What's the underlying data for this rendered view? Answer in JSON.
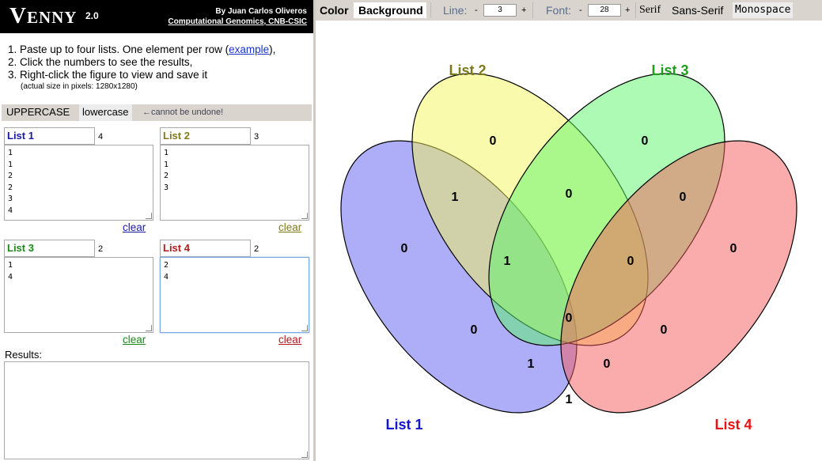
{
  "header": {
    "logo_main": "V",
    "logo_rest": "ENNY",
    "version": "2.0",
    "author_line": "By Juan Carlos Oliveros",
    "affiliation_link": "Computational Genomics, CNB-CSIC"
  },
  "instructions": {
    "step1_prefix": "1. Paste up to four lists. One element per row (",
    "step1_link": "example",
    "step1_suffix": "),",
    "step2": "2. Click the numbers to see the results,",
    "step3": "3. Right-click the figure to view and save it",
    "note": "(actual size in pixels: 1280x1280)"
  },
  "casebar": {
    "uppercase": "UPPERCASE",
    "lowercase": "lowercase",
    "warning": "←cannot be undone!"
  },
  "lists": [
    {
      "name": "List 1",
      "count": "4",
      "content": "1\n1\n2\n2\n3\n4",
      "clear": "clear",
      "color": "#1a1aa6"
    },
    {
      "name": "List 2",
      "count": "3",
      "content": "1\n1\n2\n3",
      "clear": "clear",
      "color": "#807a1a"
    },
    {
      "name": "List 3",
      "count": "2",
      "content": "1\n4",
      "clear": "clear",
      "color": "#1a8a1a"
    },
    {
      "name": "List 4",
      "count": "2",
      "content": "2\n4",
      "clear": "clear",
      "color": "#b31a1a"
    }
  ],
  "results": {
    "label": "Results:",
    "value": ""
  },
  "toolbar": {
    "color": "Color",
    "background": "Background",
    "line_label": "Line:",
    "line_value": "3",
    "font_label": "Font:",
    "font_value": "28",
    "minus": "-",
    "plus": "+",
    "serif": "Serif",
    "sans": "Sans-Serif",
    "mono": "Monospace"
  },
  "venn": {
    "labels": {
      "list1": "List 1",
      "list2": "List 2",
      "list3": "List 3",
      "list4": "List 4"
    },
    "counts": {
      "only1": "0",
      "only2": "0",
      "only3": "0",
      "only4": "0",
      "l12": "1",
      "l13": "0",
      "l14": "1",
      "l23": "0",
      "l24": "0",
      "l34": "0",
      "l123": "1",
      "l124": "1",
      "l134": "0",
      "l234": "0",
      "l1234": "0"
    },
    "colors": {
      "list1": "#5b5bf2",
      "list2": "#f5f55a",
      "list3": "#5af56a",
      "list4": "#f55a5a",
      "label1": "#1414d4",
      "label2": "#7d7a1a",
      "label3": "#1f9e1f",
      "label4": "#e61414"
    }
  }
}
